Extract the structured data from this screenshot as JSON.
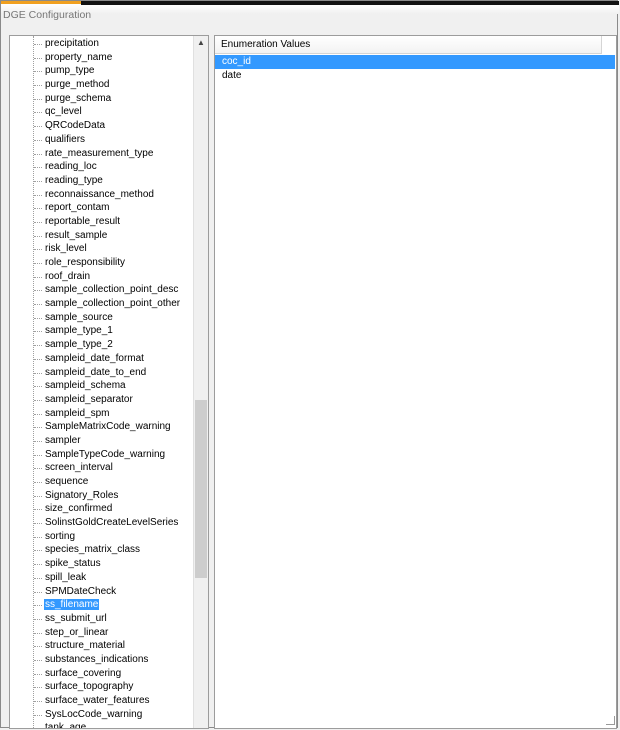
{
  "window": {
    "title": "DGE Configuration"
  },
  "tree": {
    "items": [
      "precipitation",
      "property_name",
      "pump_type",
      "purge_method",
      "purge_schema",
      "qc_level",
      "QRCodeData",
      "qualifiers",
      "rate_measurement_type",
      "reading_loc",
      "reading_type",
      "reconnaissance_method",
      "report_contam",
      "reportable_result",
      "result_sample",
      "risk_level",
      "role_responsibility",
      "roof_drain",
      "sample_collection_point_desc",
      "sample_collection_point_other",
      "sample_source",
      "sample_type_1",
      "sample_type_2",
      "sampleid_date_format",
      "sampleid_date_to_end",
      "sampleid_schema",
      "sampleid_separator",
      "sampleid_spm",
      "SampleMatrixCode_warning",
      "sampler",
      "SampleTypeCode_warning",
      "screen_interval",
      "sequence",
      "Signatory_Roles",
      "size_confirmed",
      "SolinstGoldCreateLevelSeries",
      "sorting",
      "species_matrix_class",
      "spike_status",
      "spill_leak",
      "SPMDateCheck",
      "ss_filename",
      "ss_submit_url",
      "step_or_linear",
      "structure_material",
      "substances_indications",
      "surface_covering",
      "surface_topography",
      "surface_water_features",
      "SysLocCode_warning",
      "tank_age"
    ],
    "selected_index": 41,
    "scroll": {
      "up_icon": "triangle-up",
      "down_icon": "triangle-down"
    }
  },
  "enum": {
    "header": "Enumeration Values",
    "rows": [
      "coc_id",
      "date"
    ],
    "selected_index": 0
  },
  "colors": {
    "selection": "#3399ff",
    "accent": "#f0a020"
  }
}
